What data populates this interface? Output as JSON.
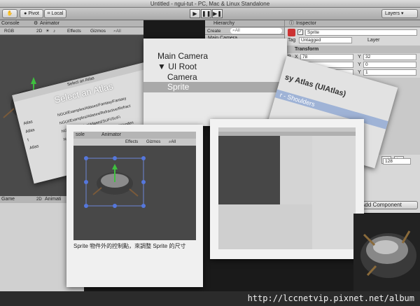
{
  "window": {
    "title": "Untitled - ngui-tut - PC, Mac & Linux Standalone"
  },
  "toolbar": {
    "pivot": "Pivot",
    "local": "Local",
    "layers": "Layers"
  },
  "scene_panel": {
    "tab_console": "Console",
    "tab_animator": "Animator",
    "rgb": "RGB",
    "mode_2d": "2D",
    "effects": "Effects",
    "gizmos": "Gizmos",
    "search": "All",
    "tab_game": "Game",
    "tab_animation": "Animati"
  },
  "hierarchy": {
    "title": "Hierarchy",
    "create": "Create",
    "search": "All",
    "first": "Main Camera"
  },
  "hier_card": {
    "items": [
      "Main Camera",
      "UI Root",
      "Camera",
      "Sprite"
    ]
  },
  "inspector": {
    "title": "Inspector",
    "object": "Sprite",
    "tag_label": "Tag",
    "tag_value": "Untagged",
    "layer_label": "Layer",
    "transform": "Transform",
    "p": "P",
    "r": "R",
    "s": "S",
    "px": "78",
    "py": "32",
    "rx": "0",
    "ry": "0",
    "sx": "1",
    "sy": "1",
    "x": "X",
    "y": "Y",
    "size_value": "128",
    "add_component": "Add Component"
  },
  "atlas_card": {
    "title": "Select an Atlas",
    "heading": "Select an Atlas",
    "labels": [
      "Atlas",
      "Atlas",
      "t",
      "Atlas"
    ],
    "paths": [
      "NGUI/Examples/Atlases/Fantasy/Fantasy",
      "NGUI/Examples/Atlases/Refractive/Refract",
      "NGUI/Examples/Atlases/SciFi/SciFi",
      "NGUI/Examples/Atlases/Wooden/Wooden"
    ]
  },
  "uiatlas_card": {
    "title": "sy Atlas (UIAtlas)",
    "sub": "r - Shoulders"
  },
  "photo_left": {
    "tab_console": "sole",
    "tab_animator": "Animator",
    "effects": "Effects",
    "gizmos": "Gizmos",
    "search": "All",
    "caption": "Sprite 物件外的控制點，來調整 Sprite 的尺寸"
  },
  "footer": {
    "url": "http://lccnetvip.pixnet.net/album"
  }
}
